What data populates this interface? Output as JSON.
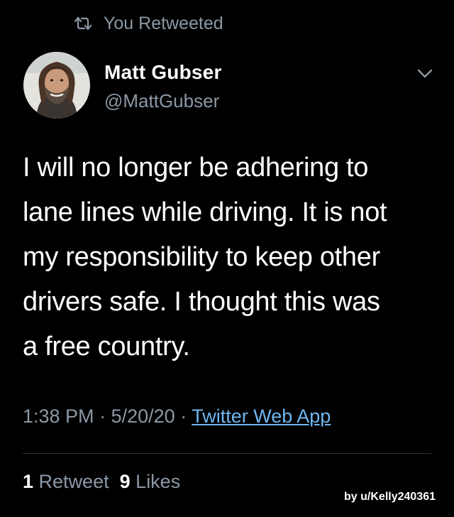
{
  "retweet_context": {
    "icon": "retweet-icon",
    "label": "You Retweeted"
  },
  "author": {
    "display_name": "Matt Gubser",
    "handle": "@MattGubser",
    "avatar": "profile-photo",
    "menu_icon": "chevron-down-icon"
  },
  "tweet": {
    "lines": [
      "I will no longer be adhering to",
      "lane lines while driving. It is not",
      "my responsibility to keep other",
      "drivers safe. I thought this was",
      "a free country."
    ]
  },
  "meta": {
    "time": "1:38 PM",
    "separator": "·",
    "date": "5/20/20",
    "source": "Twitter Web App"
  },
  "stats": {
    "retweets_count": "1",
    "retweets_label": "Retweet",
    "likes_count": "9",
    "likes_label": "Likes"
  },
  "watermark": "by u/Kelly240361",
  "colors": {
    "background": "#000000",
    "text": "#ffffff",
    "secondary": "#8b98a5",
    "link": "#6fb6f2",
    "divider": "#2f3336"
  }
}
